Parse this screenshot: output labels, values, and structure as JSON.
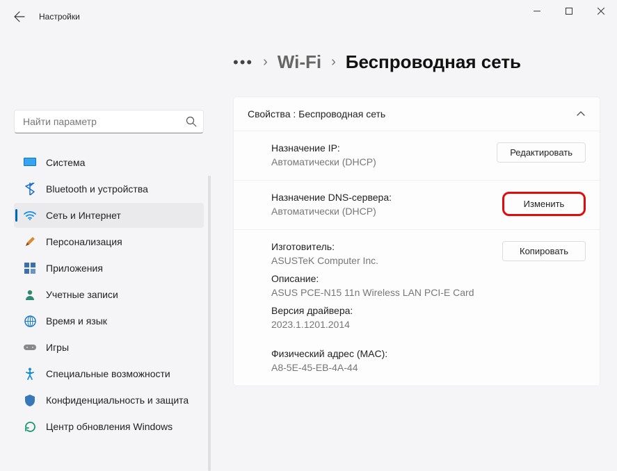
{
  "window": {
    "title": "Настройки"
  },
  "search": {
    "placeholder": "Найти параметр"
  },
  "nav": {
    "items": [
      {
        "label": "Система"
      },
      {
        "label": "Bluetooth и устройства"
      },
      {
        "label": "Сеть и Интернет"
      },
      {
        "label": "Персонализация"
      },
      {
        "label": "Приложения"
      },
      {
        "label": "Учетные записи"
      },
      {
        "label": "Время и язык"
      },
      {
        "label": "Игры"
      },
      {
        "label": "Специальные возможности"
      },
      {
        "label": "Конфиденциальность и защита"
      },
      {
        "label": "Центр обновления Windows"
      }
    ]
  },
  "breadcrumb": {
    "parent": "Wi-Fi",
    "current": "Беспроводная сеть"
  },
  "panel": {
    "header": "Свойства : Беспроводная сеть",
    "ip": {
      "label": "Назначение IP:",
      "value": "Автоматически (DHCP)",
      "button": "Редактировать"
    },
    "dns": {
      "label": "Назначение DNS-сервера:",
      "value": "Автоматически (DHCP)",
      "button": "Изменить"
    },
    "info": {
      "copy_button": "Копировать",
      "manufacturer_label": "Изготовитель:",
      "manufacturer_value": "ASUSTeK Computer Inc.",
      "description_label": "Описание:",
      "description_value": "ASUS PCE-N15 11n Wireless LAN PCI-E Card",
      "driver_label": "Версия драйвера:",
      "driver_value": "2023.1.1201.2014",
      "mac_label": "Физический адрес (MAC):",
      "mac_value": "A8-5E-45-EB-4A-44"
    }
  }
}
